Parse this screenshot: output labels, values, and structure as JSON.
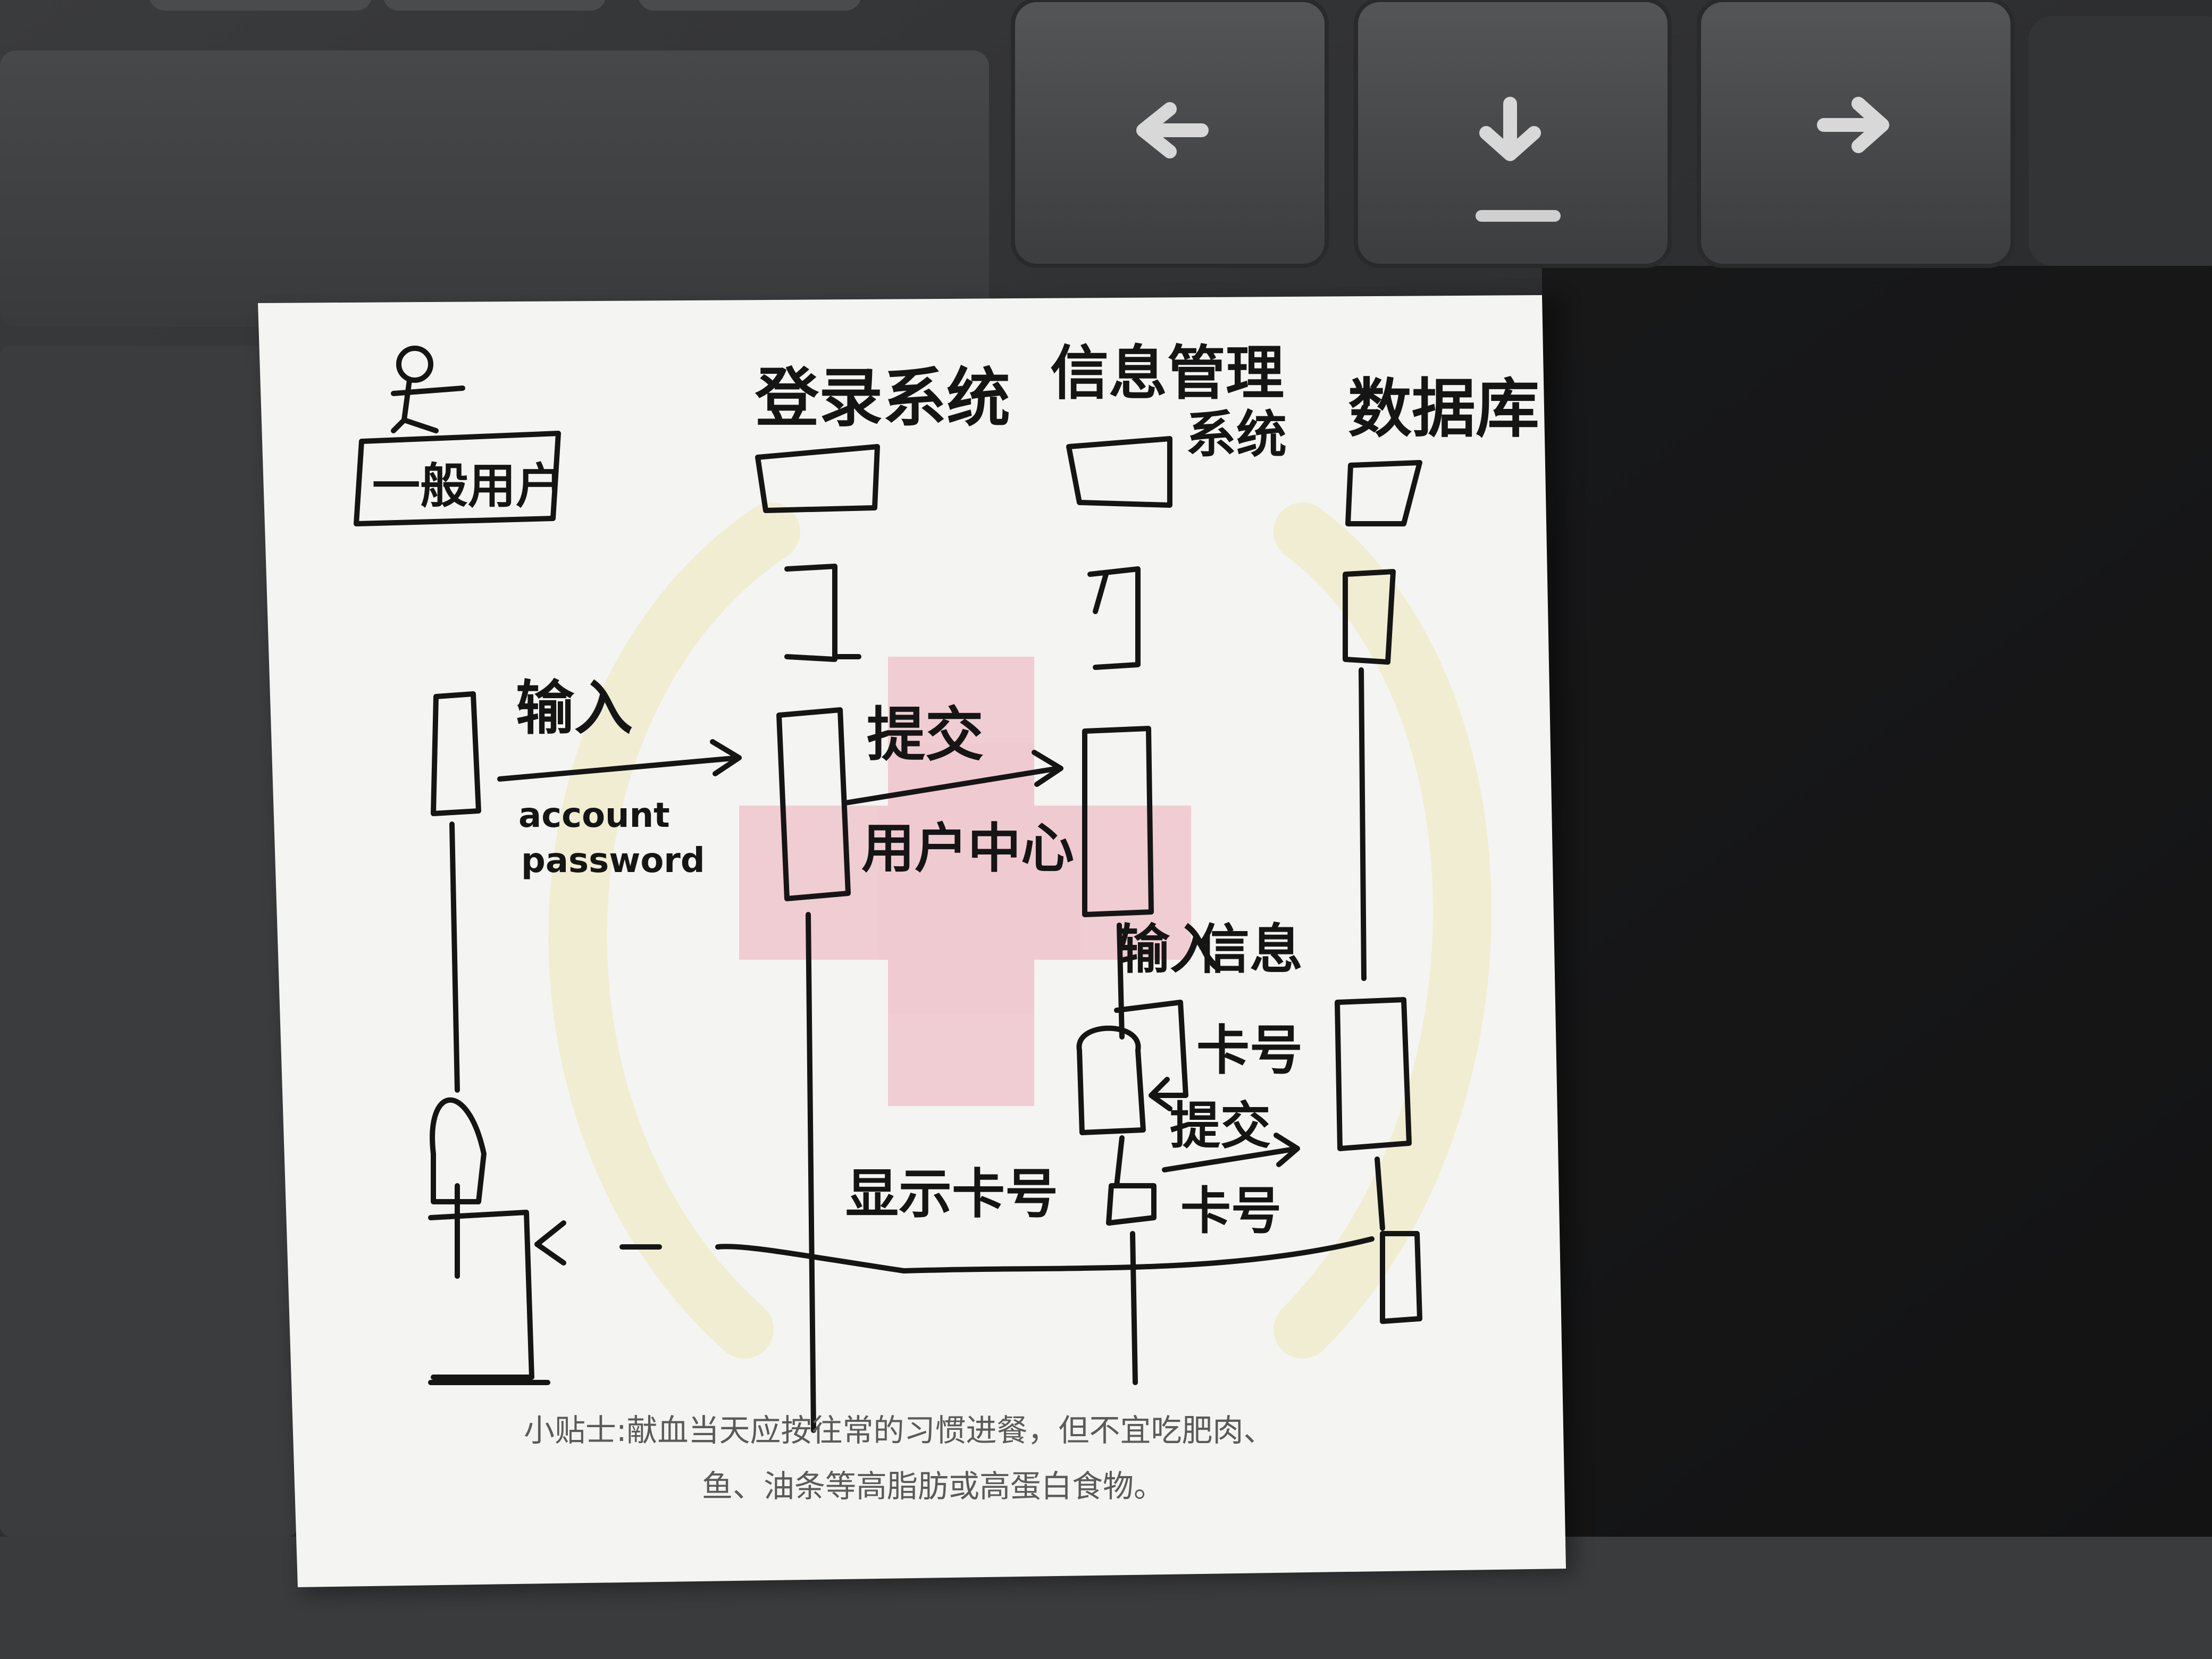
{
  "colors": {
    "desk": "#2b2b2c",
    "trackpad": "#3e3f41",
    "key": "#4a4b4d",
    "paper": "#f4f4f2",
    "ink": "#151515",
    "cross": "#efc9cf",
    "wreath": "#f3efc9"
  },
  "keyboard": {
    "keys": [
      {
        "name": "left-arrow-key",
        "icon": "arrow-left-icon",
        "glyph": "←"
      },
      {
        "name": "down-arrow-key",
        "icon": "arrow-down-icon",
        "glyph": "↓"
      },
      {
        "name": "right-arrow-key",
        "icon": "arrow-right-icon",
        "glyph": "→"
      }
    ]
  },
  "note": {
    "actor_label": "一般用户",
    "lifelines": {
      "login": "登录系统",
      "info_line1": "信息管理",
      "info_line2": "系统",
      "db": "数据库"
    },
    "messages": {
      "input": "输入",
      "input_params_1": "account",
      "input_params_2": "password",
      "submit": "提交",
      "user_center": "用户中心",
      "enter_info_1": "输入",
      "enter_info_2": "信息",
      "card_no": "卡号",
      "submit_card_1": "提交",
      "submit_card_2": "卡号",
      "show_card": "显示卡号"
    },
    "printed_tip_line1": "小贴士:献血当天应按往常的习惯进餐，但不宜吃肥肉、",
    "printed_tip_line2": "鱼、油条等高脂肪或高蛋白食物。"
  }
}
